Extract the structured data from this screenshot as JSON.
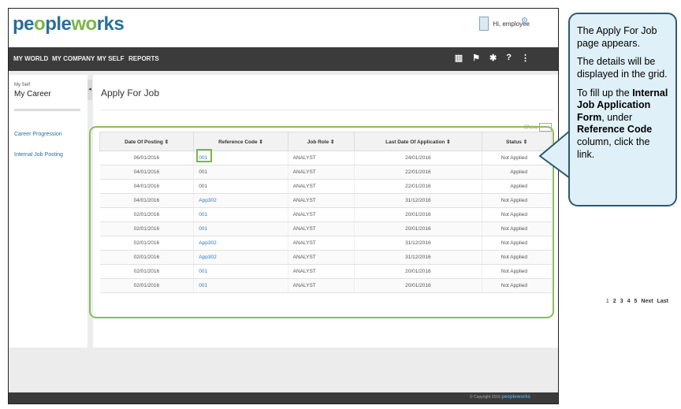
{
  "app": {
    "logo_blue": "pe",
    "logo_mid": "ple",
    "logo_green": "w",
    "logo_end": "rks",
    "logo_o1": "o",
    "logo_o2": "o"
  },
  "header": {
    "greeting": "Hi, employee"
  },
  "nav": {
    "items": [
      "MY WORLD",
      "MY COMPANY",
      "MY SELF",
      "REPORTS"
    ]
  },
  "sidebar": {
    "breadcrumb": "My Self",
    "title": "My Career",
    "links": [
      "Career Progression",
      "Internal Job Posting"
    ]
  },
  "main": {
    "title": "Apply For Job",
    "show_label": "Show"
  },
  "grid": {
    "headers": [
      "Date Of Posting ⇕",
      "Reference Code ⇕",
      "Job Role ⇕",
      "Last Date Of Application ⇕",
      "Status ⇕"
    ],
    "rows": [
      [
        "06/01/2016",
        "001",
        "ANALYST",
        "24/01/2016",
        "Not Applied"
      ],
      [
        "04/01/2016",
        "001",
        "ANALYST",
        "22/01/2016",
        "Applied"
      ],
      [
        "04/01/2016",
        "001",
        "ANALYST",
        "22/01/2016",
        "Applied"
      ],
      [
        "04/01/2016",
        "App302",
        "ANALYST",
        "31/12/2016",
        "Not Applied"
      ],
      [
        "02/01/2016",
        "001",
        "ANALYST",
        "20/01/2016",
        "Not Applied"
      ],
      [
        "02/01/2016",
        "001",
        "ANALYST",
        "20/01/2016",
        "Not Applied"
      ],
      [
        "02/01/2016",
        "App302",
        "ANALYST",
        "31/12/2016",
        "Not Applied"
      ],
      [
        "02/01/2016",
        "App302",
        "ANALYST",
        "31/12/2016",
        "Not Applied"
      ],
      [
        "02/01/2016",
        "001",
        "ANALYST",
        "20/01/2016",
        "Not Applied"
      ],
      [
        "02/01/2016",
        "001",
        "ANALYST",
        "20/01/2016",
        "Not Applied"
      ]
    ],
    "link_rows": [
      0,
      3,
      4,
      5,
      6,
      7,
      8,
      9
    ]
  },
  "pager": {
    "pages": [
      "1",
      "2",
      "3",
      "4",
      "5"
    ],
    "next": "Next",
    "last": "Last"
  },
  "footer": {
    "copyright": "© Copyright 2016",
    "brand": "peopleworks"
  },
  "callout": {
    "p1": "The Apply For Job page appears.",
    "p2": "The details will be displayed in the grid.",
    "p3_a": "To fill up the ",
    "p3_b": "Internal Job Application Form",
    "p3_c": ", under ",
    "p3_d": "Reference Code",
    "p3_e": " column, click the link."
  },
  "colors": {
    "brand_blue": "#2a6f97",
    "brand_green": "#7ab648",
    "nav_bg": "#3b3b3b",
    "highlight": "#8bbd5c"
  }
}
